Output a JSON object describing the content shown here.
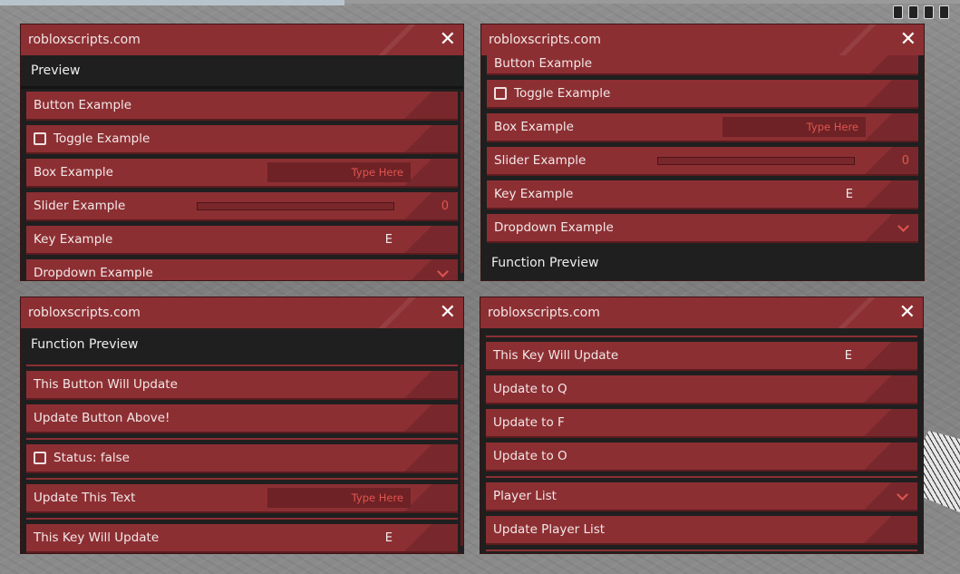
{
  "site": "robloxscripts.com",
  "close_glyph": "✕",
  "box_placeholder": "Type Here",
  "win1": {
    "section": "Preview",
    "button": "Button Example",
    "toggle": "Toggle Example",
    "box": "Box Example",
    "slider": "Slider Example",
    "slider_value": "0",
    "key": "Key Example",
    "key_value": "E",
    "dropdown": "Dropdown Example"
  },
  "win2": {
    "button": "Button Example",
    "toggle": "Toggle Example",
    "box": "Box Example",
    "slider": "Slider Example",
    "slider_value": "0",
    "key": "Key Example",
    "key_value": "E",
    "dropdown": "Dropdown Example",
    "section": "Function Preview"
  },
  "win3": {
    "section": "Function Preview",
    "update_button": "This Button Will Update",
    "update_above": "Update Button Above!",
    "status": "Status: false",
    "update_text": "Update This Text",
    "update_key": "This Key Will Update",
    "key_value": "E"
  },
  "win4": {
    "update_key": "This Key Will Update",
    "key_value": "E",
    "to_q": "Update to Q",
    "to_f": "Update to F",
    "to_o": "Update to O",
    "player_list": "Player List",
    "update_players": "Update Player List"
  },
  "colors": {
    "accent": "#8c2f33",
    "dark": "#1f1f1f",
    "value_red": "#e0554f"
  }
}
